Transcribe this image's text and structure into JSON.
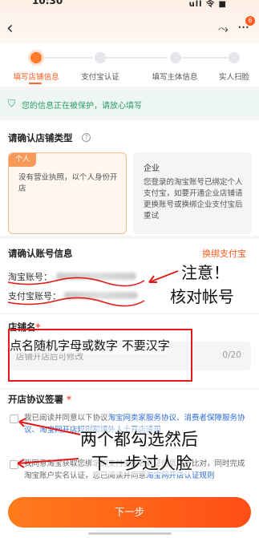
{
  "status_bar": {
    "time": "10:30",
    "signal_text": "ull 令 ■"
  },
  "nav": {
    "back_icon": "chevron-left-icon",
    "share_icon": "share-icon",
    "more_icon": "more-icon",
    "badge_count": "6"
  },
  "steps": [
    {
      "label": "填写店铺信息",
      "active": true
    },
    {
      "label": "支付宝认证",
      "active": false
    },
    {
      "label": "填写主体信息",
      "active": false
    },
    {
      "label": "实人扫脸",
      "active": false
    }
  ],
  "protect_notice": "您的信息正在被保护，请放心填写",
  "shop_type": {
    "title": "请确认店铺类型",
    "personal": {
      "tag": "个人",
      "desc": "没有营业执照，以个人身份开店"
    },
    "company": {
      "title": "企业",
      "desc": "您登录的淘宝账号已绑定个人支付宝，如要开通企业店铺请更换账号或换绑企业支付宝后重试"
    }
  },
  "account": {
    "title": "请确认账号信息",
    "switch_label": "换绑支付宝",
    "taobao_label": "淘宝账号：",
    "alipay_label": "支付宝账号："
  },
  "shop_name": {
    "title": "店铺名",
    "required_mark": "*",
    "placeholder": "店铺开店后可修改",
    "counter": "0/20"
  },
  "agreement": {
    "title": "开店协议签署",
    "required_mark": "*",
    "item1_prefix": "我已阅读并同意以下协议",
    "item1_links": "淘宝网卖家服务协议、消费者保障服务协议、淘宝网开店规则和境外人士开店适用",
    "item2_prefix": "我同意淘宝获取您绑定的支付宝实名认证信息进行比对，同时完成淘宝账户实名认证，您已阅读并同意",
    "item2_links": "淘宝网开店认证规则"
  },
  "submit_label": "下一步",
  "annotations": {
    "note1_line1": "注意！",
    "note1_line2": "核对帐号",
    "note2": "点名随机字母或数字 不要汉字",
    "note3_line1": "两个都勾选然后",
    "note3_line2": "下一步过人脸"
  },
  "colors": {
    "accent": "#ff5a1f",
    "link": "#2f6ed8",
    "protect": "#2d9b6f",
    "annotation": "#e21a1a"
  }
}
